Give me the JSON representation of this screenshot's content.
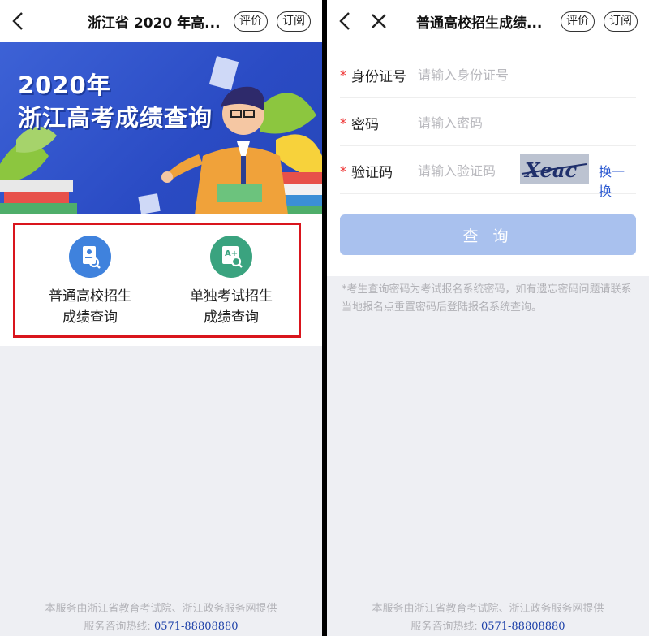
{
  "left": {
    "title": "浙江省 2020 年高...",
    "pill_rate": "评价",
    "pill_subscribe": "订阅",
    "banner": {
      "line1": "2020年",
      "line2": "浙江高考成绩查询"
    },
    "options": [
      {
        "line1": "普通高校招生",
        "line2": "成绩查询"
      },
      {
        "line1": "单独考试招生",
        "line2": "成绩查询"
      }
    ],
    "footer": {
      "line1": "本服务由浙江省教育考试院、浙江政务服务网提供",
      "hotline_label": "服务咨询热线:",
      "hotline": "0571-88808880"
    }
  },
  "right": {
    "title": "普通高校招生成绩...",
    "pill_rate": "评价",
    "pill_subscribe": "订阅",
    "form": {
      "id_label": "身份证号",
      "id_placeholder": "请输入身份证号",
      "pwd_label": "密码",
      "pwd_placeholder": "请输入密码",
      "code_label": "验证码",
      "code_placeholder": "请输入验证码",
      "refresh": "换一换",
      "captcha_text": "Xeac",
      "submit": "查 询"
    },
    "note": "*考生查询密码为考试报名系统密码，如有遗忘密码问题请联系当地报名点重置密码后登陆报名系统查询。",
    "footer": {
      "line1": "本服务由浙江省教育考试院、浙江政务服务网提供",
      "hotline_label": "服务咨询热线:",
      "hotline": "0571-88808880"
    }
  },
  "colors": {
    "accent": "#2c5ad1",
    "highlight_box": "#d9151d",
    "banner_blue": "#2a4bc4"
  },
  "icons": [
    "back-icon",
    "close-icon",
    "id-card-search-icon",
    "grade-search-icon"
  ]
}
